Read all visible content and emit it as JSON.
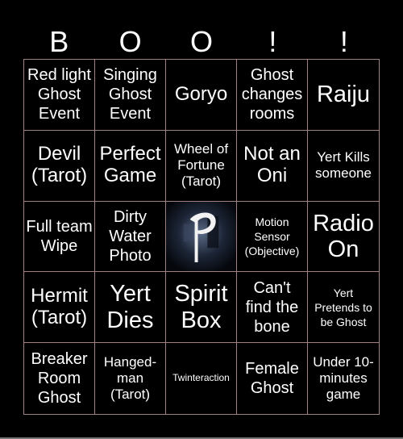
{
  "header": {
    "letters": [
      "B",
      "O",
      "O",
      "!",
      "!"
    ]
  },
  "cells": [
    {
      "text": "Red light Ghost Event",
      "size": "s-m"
    },
    {
      "text": "Singing Ghost Event",
      "size": "s-m"
    },
    {
      "text": "Goryo",
      "size": "s-l"
    },
    {
      "text": "Ghost changes rooms",
      "size": "s-m"
    },
    {
      "text": "Raiju",
      "size": "s-xl"
    },
    {
      "text": "Devil (Tarot)",
      "size": "s-l"
    },
    {
      "text": "Perfect Game",
      "size": "s-l"
    },
    {
      "text": "Wheel of Fortune (Tarot)",
      "size": "s-s"
    },
    {
      "text": "Not an Oni",
      "size": "s-l"
    },
    {
      "text": "Yert Kills someone",
      "size": "s-s"
    },
    {
      "text": "Full team Wipe",
      "size": "s-m"
    },
    {
      "text": "Dirty Water Photo",
      "size": "s-m"
    },
    {
      "text": "",
      "free": true,
      "icon": "phasmophobia-logo-icon"
    },
    {
      "text": "Motion Sensor (Objective)",
      "size": "s-xs"
    },
    {
      "text": "Radio On",
      "size": "s-xl"
    },
    {
      "text": "Hermit (Tarot)",
      "size": "s-l"
    },
    {
      "text": "Yert Dies",
      "size": "s-xl"
    },
    {
      "text": "Spirit Box",
      "size": "s-xl"
    },
    {
      "text": "Can't find the bone",
      "size": "s-m"
    },
    {
      "text": "Yert Pretends to be Ghost",
      "size": "s-xs"
    },
    {
      "text": "Breaker Room Ghost",
      "size": "s-m"
    },
    {
      "text": "Hanged-man (Tarot)",
      "size": "s-s"
    },
    {
      "text": "Twinteraction",
      "size": "s-xxs"
    },
    {
      "text": "Female Ghost",
      "size": "s-m"
    },
    {
      "text": "Under 10-minutes game",
      "size": "s-s"
    }
  ]
}
